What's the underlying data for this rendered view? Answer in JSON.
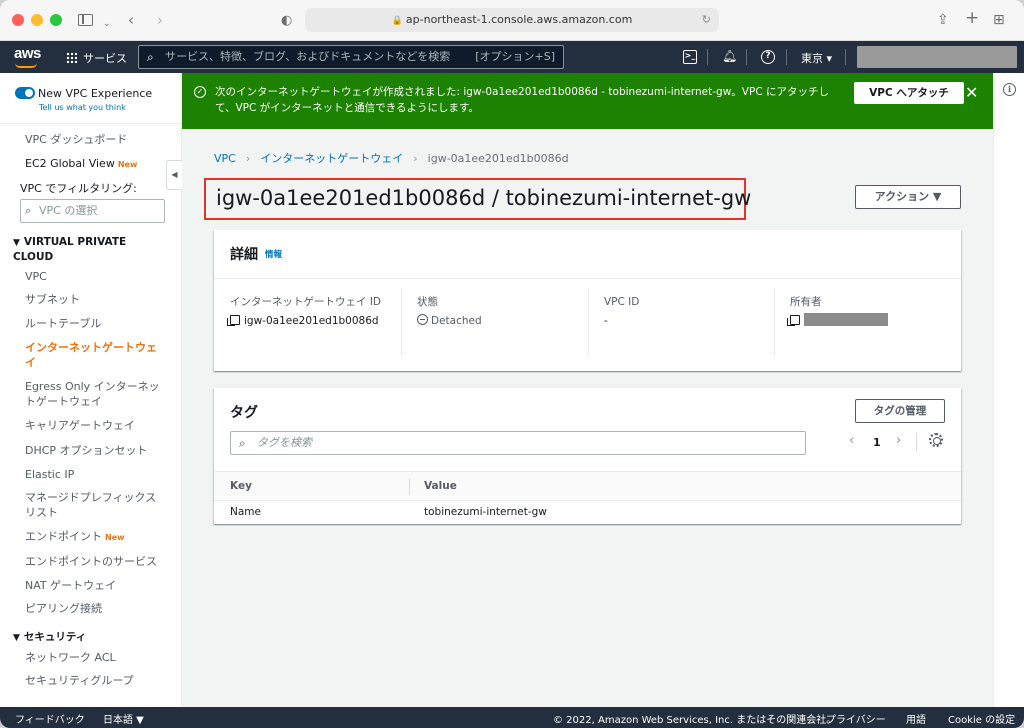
{
  "browser": {
    "url": "ap-northeast-1.console.aws.amazon.com"
  },
  "aws_nav": {
    "logo": "aws",
    "services_label": "サービス",
    "search_placeholder": "サービス、特徴、ブログ、およびドキュメントなどを検索",
    "search_shortcut": "[オプション+S]",
    "region_label": "東京 ▾"
  },
  "side_nav": {
    "toggle_label": "New VPC Experience",
    "tell_us": "Tell us what you think",
    "dashboard": "VPC ダッシュボード",
    "ec2_global": "EC2 Global View",
    "new_badge": "New",
    "filter_label": "VPC でフィルタリング:",
    "filter_placeholder": "VPC の選択",
    "section_vpc": "VIRTUAL PRIVATE CLOUD",
    "items": [
      {
        "label": "VPC"
      },
      {
        "label": "サブネット"
      },
      {
        "label": "ルートテーブル"
      },
      {
        "label": "インターネットゲートウェイ"
      },
      {
        "label": "Egress Only インターネットゲートウェイ"
      },
      {
        "label": "キャリアゲートウェイ"
      },
      {
        "label": "DHCP オプションセット"
      },
      {
        "label": "Elastic IP"
      },
      {
        "label": "マネージドプレフィックスリスト"
      },
      {
        "label": "エンドポイント"
      },
      {
        "label": "エンドポイントのサービス"
      },
      {
        "label": "NAT ゲートウェイ"
      },
      {
        "label": "ピアリング接続"
      }
    ],
    "section_security": "セキュリティ",
    "security_items": [
      {
        "label": "ネットワーク ACL"
      },
      {
        "label": "セキュリティグループ"
      }
    ]
  },
  "flash": {
    "message": "次のインターネットゲートウェイが作成されました: igw-0a1ee201ed1b0086d - tobinezumi-internet-gw。VPC にアタッチして、VPC がインターネットと通信できるようにします。",
    "attach_button": "VPC へアタッチ",
    "close": "✕"
  },
  "breadcrumb": {
    "vpc": "VPC",
    "igw": "インターネットゲートウェイ",
    "current": "igw-0a1ee201ed1b0086d"
  },
  "page": {
    "title": "igw-0a1ee201ed1b0086d / tobinezumi-internet-gw",
    "actions_label": "アクション ▼"
  },
  "details": {
    "header": "詳細",
    "info_link": "情報",
    "igw_id_label": "インターネットゲートウェイ ID",
    "igw_id_value": "igw-0a1ee201ed1b0086d",
    "state_label": "状態",
    "state_value": "Detached",
    "vpc_id_label": "VPC ID",
    "vpc_id_value": "-",
    "owner_label": "所有者"
  },
  "tags": {
    "header": "タグ",
    "manage_button": "タグの管理",
    "search_placeholder": "タグを検索",
    "page_number": "1",
    "columns": [
      "Key",
      "Value"
    ],
    "rows": [
      {
        "key": "Name",
        "value": "tobinezumi-internet-gw"
      }
    ]
  },
  "footer": {
    "feedback": "フィードバック",
    "language": "日本語 ▼",
    "copyright": "© 2022, Amazon Web Services, Inc. またはその関連会社。",
    "privacy": "プライバシー",
    "terms": "用語",
    "cookie": "Cookie の設定"
  }
}
